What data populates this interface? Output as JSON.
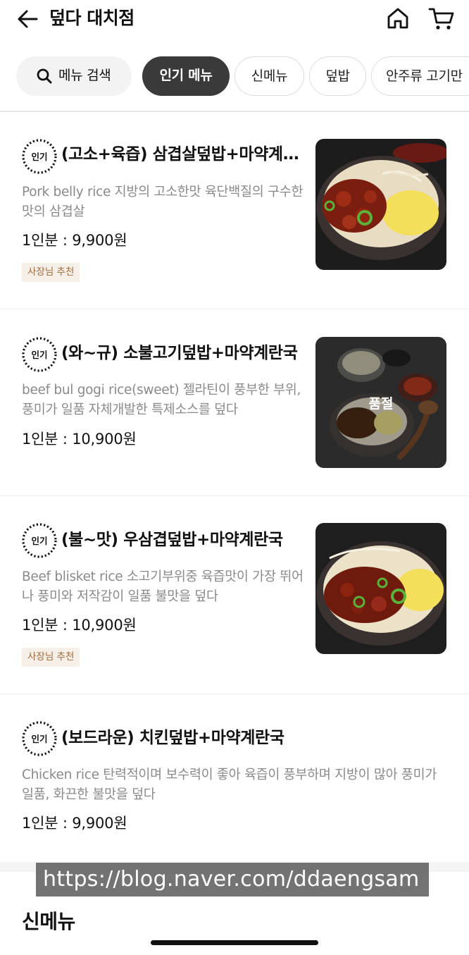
{
  "header": {
    "title": "덮다 대치점",
    "back_icon": "arrow-left-icon",
    "home_icon": "home-icon",
    "cart_icon": "cart-icon"
  },
  "chips": {
    "search_label": "메뉴 검색",
    "tabs": [
      "인기 메뉴",
      "신메뉴",
      "덮밥",
      "안주류 고기만"
    ],
    "active": "인기 메뉴"
  },
  "menu_items": [
    {
      "badge": "인기",
      "name": "(고소+육즙) 삼겹살덮밥+마약계란국",
      "desc": "Pork belly rice 지방의 고소한맛 육단백질의 구수한맛의 삼겹살",
      "price": "1인분 : 9,900원",
      "tag": "사장님 추천",
      "sold_out": ""
    },
    {
      "badge": "인기",
      "name": "(와~규) 소불고기덮밥+마약계란국",
      "desc": "beef bul gogi rice(sweet) 젤라틴이 풍부한 부위, 풍미가 일품 자체개발한 특제소스를 덮다",
      "price": "1인분 : 10,900원",
      "tag": "",
      "sold_out": "품절"
    },
    {
      "badge": "인기",
      "name": "(불~맛) 우삼겹덮밥+마약계란국",
      "desc": "Beef blisket rice 소고기부위중 육즙맛이 가장 뛰어나 풍미와 저작감이 일품 불맛을 덮다",
      "price": "1인분 : 10,900원",
      "tag": "사장님 추천",
      "sold_out": ""
    },
    {
      "badge": "인기",
      "name": "(보드라운) 치킨덮밥+마약계란국",
      "desc": "Chicken rice 탄력적이며 보수력이 좋아 육즙이 풍부하며 지방이 많아 풍미가 일품, 화끈한 불맛을 덮다",
      "price": "1인분 : 9,900원",
      "tag": "",
      "sold_out": ""
    }
  ],
  "watermark": "https://blog.naver.com/ddaengsam",
  "next_section_title": "신메뉴"
}
